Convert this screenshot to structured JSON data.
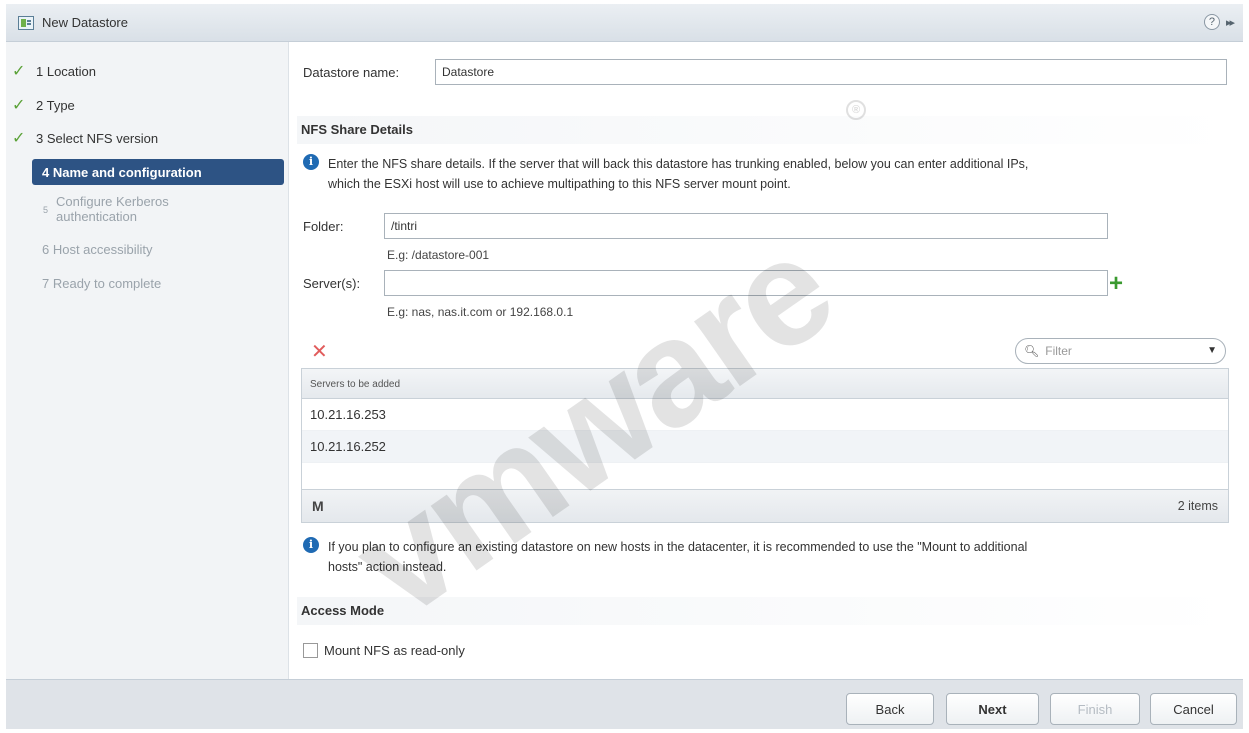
{
  "window": {
    "title": "New Datastore",
    "help_glyph": "?",
    "expand_glyph": "▸▸"
  },
  "steps": [
    {
      "label": "1  Location",
      "state": "done"
    },
    {
      "label": "2  Type",
      "state": "done"
    },
    {
      "label": "3  Select NFS version",
      "state": "done"
    },
    {
      "label": "4  Name and configuration",
      "state": "active"
    },
    {
      "num": "5",
      "label_line1": "Configure Kerberos",
      "label_line2": "authentication",
      "state": "future"
    },
    {
      "label": "6  Host accessibility",
      "state": "future"
    },
    {
      "label": "7  Ready to complete",
      "state": "future"
    }
  ],
  "form": {
    "name_label": "Datastore name:",
    "name_value": "Datastore",
    "nfs_section_title": "NFS Share Details",
    "nfs_info_line1": "Enter the NFS share details. If the server that will back this datastore has trunking enabled, below you can enter additional IPs,",
    "nfs_info_line2": "which the ESXi host will use to achieve multipathing to this NFS server mount point.",
    "folder_label": "Folder:",
    "folder_value": "/tintri",
    "folder_hint": "E.g: /datastore-001",
    "server_label": "Server(s):",
    "server_value": "",
    "server_hint": "E.g: nas, nas.it.com or 192.168.0.1"
  },
  "servers_grid": {
    "filter_placeholder": "Filter",
    "column_header": "Servers to be added",
    "rows": [
      "10.21.16.253",
      "10.21.16.252"
    ],
    "item_count": "2 items"
  },
  "mount_info_line1": "If you plan to configure an existing datastore on new hosts in the datacenter, it is recommended to use the \"Mount to additional",
  "mount_info_line2": "hosts\" action instead.",
  "access_mode": {
    "section_title": "Access Mode",
    "readonly_label": "Mount NFS as read-only",
    "readonly_checked": false
  },
  "buttons": {
    "back": "Back",
    "next": "Next",
    "finish": "Finish",
    "cancel": "Cancel"
  },
  "watermark": {
    "text": "vmware",
    "mark": "®"
  },
  "colors": {
    "active_step": "#2d5384",
    "check": "#5ba238",
    "info": "#1f6ab3",
    "add": "#3a9a2f",
    "delete": "#e15c5c"
  }
}
